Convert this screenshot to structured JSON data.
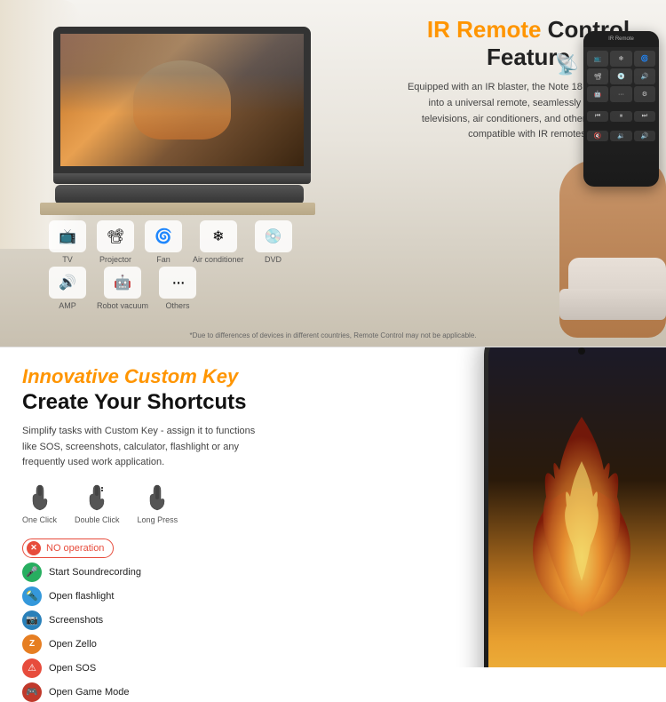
{
  "top_section": {
    "title_part1": "IR Remote",
    "title_part2": " Control Feature",
    "description": "Equipped with an IR blaster, the Note 18 Pro\ntransforms into a universal remote, seamlessly\ncontrolling televisions, air conditioners,\nand other appliances compatible with IR remotes.",
    "disclaimer": "*Due to differences of devices in different countries, Remote Control may not be applicable.",
    "devices": [
      {
        "label": "TV",
        "icon": "📺"
      },
      {
        "label": "Projector",
        "icon": "📽"
      },
      {
        "label": "Fan",
        "icon": "🌀"
      },
      {
        "label": "Air conditioner",
        "icon": "❄"
      },
      {
        "label": "DVD",
        "icon": "💿"
      }
    ],
    "devices2": [
      {
        "label": "AMP",
        "icon": "🔊"
      },
      {
        "label": "Robot vacuum",
        "icon": "🔵"
      },
      {
        "label": "Others",
        "icon": "⋯"
      }
    ]
  },
  "bottom_section": {
    "title_orange": "Innovative Custom Key",
    "title_black": "Create Your Shortcuts",
    "description": "Simplify tasks with Custom Key - assign it to\nfunctions like SOS, screenshots, calculator,\nflashlight or any frequently used work application.",
    "click_types": [
      {
        "label": "One Click"
      },
      {
        "label": "Double Click"
      },
      {
        "label": "Long Press"
      }
    ],
    "features": [
      {
        "label": "NO operation",
        "bg": "#e74c3c",
        "icon": "✕",
        "is_badge": true
      },
      {
        "label": "Start Soundrecording",
        "bg": "#27ae60",
        "icon": "🎤"
      },
      {
        "label": "Open flashlight",
        "bg": "#3498db",
        "icon": "🔦"
      },
      {
        "label": "Screenshots",
        "bg": "#2980b9",
        "icon": "📸"
      },
      {
        "label": "Open Zello",
        "bg": "#e67e22",
        "icon": "Z"
      },
      {
        "label": "Open SOS",
        "bg": "#e74c3c",
        "icon": "⚠"
      },
      {
        "label": "Open Game Mode",
        "bg": "#c0392b",
        "icon": "🎮"
      }
    ]
  }
}
